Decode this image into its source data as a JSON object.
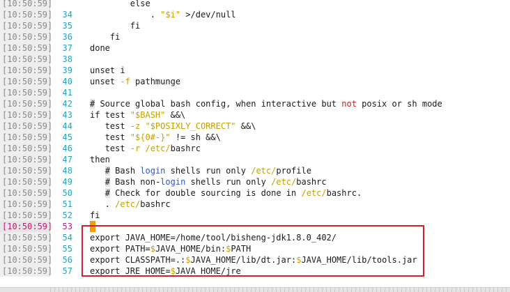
{
  "editor": {
    "lines": [
      {
        "ts": "[10:50:59]",
        "num": "",
        "tokens": [
          {
            "t": "        else",
            "c": "t-ok"
          }
        ]
      },
      {
        "ts": "[10:50:59]",
        "num": "34",
        "tokens": [
          {
            "t": "            . ",
            "c": "t-ok"
          },
          {
            "t": "\"$i\"",
            "c": "t-str"
          },
          {
            "t": " >/dev/null",
            "c": "t-ok"
          }
        ]
      },
      {
        "ts": "[10:50:59]",
        "num": "35",
        "tokens": [
          {
            "t": "        fi",
            "c": "t-ok"
          }
        ]
      },
      {
        "ts": "[10:50:59]",
        "num": "36",
        "tokens": [
          {
            "t": "    fi",
            "c": "t-ok"
          }
        ]
      },
      {
        "ts": "[10:50:59]",
        "num": "37",
        "tokens": [
          {
            "t": "done",
            "c": "t-ok"
          }
        ]
      },
      {
        "ts": "[10:50:59]",
        "num": "38",
        "tokens": []
      },
      {
        "ts": "[10:50:59]",
        "num": "39",
        "tokens": [
          {
            "t": "unset i",
            "c": "t-ok"
          }
        ]
      },
      {
        "ts": "[10:50:59]",
        "num": "40",
        "tokens": [
          {
            "t": "unset ",
            "c": "t-ok"
          },
          {
            "t": "-f",
            "c": "t-flag"
          },
          {
            "t": " pathmunge",
            "c": "t-ok"
          }
        ]
      },
      {
        "ts": "[10:50:59]",
        "num": "41",
        "tokens": []
      },
      {
        "ts": "[10:50:59]",
        "num": "42",
        "tokens": [
          {
            "t": "#",
            "c": "comment-hash"
          },
          {
            "t": " Source global bash config, when interactive but ",
            "c": "t-ok"
          },
          {
            "t": "not",
            "c": "t-kw-red"
          },
          {
            "t": " posix or sh mode",
            "c": "t-ok"
          }
        ]
      },
      {
        "ts": "[10:50:59]",
        "num": "43",
        "tokens": [
          {
            "t": "if test ",
            "c": "t-ok"
          },
          {
            "t": "\"$BASH\"",
            "c": "t-str"
          },
          {
            "t": " &&\\",
            "c": "t-ok"
          }
        ]
      },
      {
        "ts": "[10:50:59]",
        "num": "44",
        "tokens": [
          {
            "t": "   test ",
            "c": "t-ok"
          },
          {
            "t": "-z",
            "c": "t-flag"
          },
          {
            "t": " ",
            "c": "t-ok"
          },
          {
            "t": "\"$POSIXLY_CORRECT\"",
            "c": "t-str"
          },
          {
            "t": " &&\\",
            "c": "t-ok"
          }
        ]
      },
      {
        "ts": "[10:50:59]",
        "num": "45",
        "tokens": [
          {
            "t": "   test ",
            "c": "t-ok"
          },
          {
            "t": "\"${0#-}\"",
            "c": "t-str"
          },
          {
            "t": " != sh &&\\",
            "c": "t-ok"
          }
        ]
      },
      {
        "ts": "[10:50:59]",
        "num": "46",
        "tokens": [
          {
            "t": "   test ",
            "c": "t-ok"
          },
          {
            "t": "-r",
            "c": "t-flag"
          },
          {
            "t": " ",
            "c": "t-ok"
          },
          {
            "t": "/etc/",
            "c": "t-str"
          },
          {
            "t": "bashrc",
            "c": "t-ok"
          }
        ]
      },
      {
        "ts": "[10:50:59]",
        "num": "47",
        "tokens": [
          {
            "t": "then",
            "c": "t-ok"
          }
        ]
      },
      {
        "ts": "[10:50:59]",
        "num": "48",
        "tokens": [
          {
            "t": "   ",
            "c": "t-ok"
          },
          {
            "t": "#",
            "c": "comment-hash"
          },
          {
            "t": " Bash ",
            "c": "t-ok"
          },
          {
            "t": "login",
            "c": "t-blue"
          },
          {
            "t": " shells run only ",
            "c": "t-ok"
          },
          {
            "t": "/etc/",
            "c": "t-str"
          },
          {
            "t": "profile",
            "c": "t-ok"
          }
        ]
      },
      {
        "ts": "[10:50:59]",
        "num": "49",
        "tokens": [
          {
            "t": "   ",
            "c": "t-ok"
          },
          {
            "t": "#",
            "c": "comment-hash"
          },
          {
            "t": " Bash non-",
            "c": "t-ok"
          },
          {
            "t": "login",
            "c": "t-blue"
          },
          {
            "t": " shells run only ",
            "c": "t-ok"
          },
          {
            "t": "/etc/",
            "c": "t-str"
          },
          {
            "t": "bashrc",
            "c": "t-ok"
          }
        ]
      },
      {
        "ts": "[10:50:59]",
        "num": "50",
        "tokens": [
          {
            "t": "   ",
            "c": "t-ok"
          },
          {
            "t": "#",
            "c": "comment-hash"
          },
          {
            "t": " Check for double sourcing is done in ",
            "c": "t-ok"
          },
          {
            "t": "/etc/",
            "c": "t-str"
          },
          {
            "t": "bashrc.",
            "c": "t-ok"
          }
        ]
      },
      {
        "ts": "[10:50:59]",
        "num": "51",
        "tokens": [
          {
            "t": "   . ",
            "c": "t-ok"
          },
          {
            "t": "/etc/",
            "c": "t-str"
          },
          {
            "t": "bashrc",
            "c": "t-ok"
          }
        ]
      },
      {
        "ts": "[10:50:59]",
        "num": "52",
        "tokens": [
          {
            "t": "fi",
            "c": "t-ok"
          }
        ]
      },
      {
        "ts": "[10:50:59]",
        "num": "53",
        "tokens": [],
        "cursor": true
      },
      {
        "ts": "[10:50:59]",
        "num": "54",
        "tokens": [
          {
            "t": "export JAVA_HOME=/home/tool/bisheng-jdk1.8.0_402/",
            "c": "t-ok"
          }
        ]
      },
      {
        "ts": "[10:50:59]",
        "num": "55",
        "tokens": [
          {
            "t": "export PATH=",
            "c": "t-ok"
          },
          {
            "t": "$",
            "c": "t-str"
          },
          {
            "t": "JAVA_HOME/bin:",
            "c": "t-ok"
          },
          {
            "t": "$",
            "c": "t-str"
          },
          {
            "t": "PATH",
            "c": "t-ok"
          }
        ]
      },
      {
        "ts": "[10:50:59]",
        "num": "56",
        "tokens": [
          {
            "t": "export CLASSPATH=.:",
            "c": "t-ok"
          },
          {
            "t": "$",
            "c": "t-str"
          },
          {
            "t": "JAVA_HOME/lib/dt.jar:",
            "c": "t-ok"
          },
          {
            "t": "$",
            "c": "t-str"
          },
          {
            "t": "JAVA_HOME/lib/tools.jar",
            "c": "t-ok"
          }
        ]
      },
      {
        "ts": "[10:50:59]",
        "num": "57",
        "tokens": [
          {
            "t": "export JRE_HOME=",
            "c": "t-ok"
          },
          {
            "t": "$",
            "c": "t-str"
          },
          {
            "t": "JAVA_HOME/jre",
            "c": "t-ok"
          }
        ]
      }
    ]
  },
  "colors": {
    "line_number": "#2aa3b5",
    "string": "#c4a000",
    "keyword_red": "#d11a1a",
    "keyword_blue": "#2f57c8",
    "cursor": "#f2a100",
    "highlight_box": "#d21f2b",
    "cursor_line_marker": "#c01b7a"
  }
}
